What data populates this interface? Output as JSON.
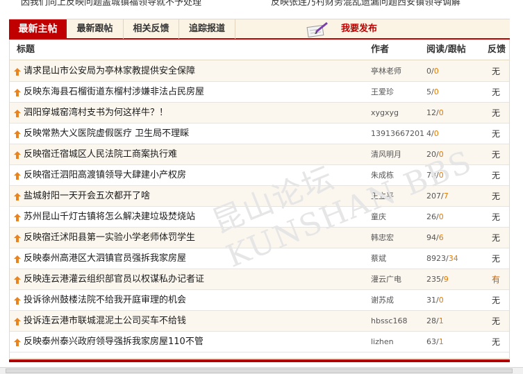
{
  "top": {
    "left_text": "因我们向上反映问题盖城镇福领导就不予处理",
    "right_text": "反映张连乃村财务混乱遗漏问题西安镇领导调解"
  },
  "tabs": [
    {
      "label": "最新主帖",
      "active": true
    },
    {
      "label": "最新跟帖",
      "active": false
    },
    {
      "label": "相关反馈",
      "active": false
    },
    {
      "label": "追踪报道",
      "active": false
    }
  ],
  "publish": {
    "label": "我要发布",
    "icon": "pen-notepad-icon"
  },
  "columns": {
    "title": "标题",
    "author": "作者",
    "stats": "阅读/跟帖",
    "feedback": "反馈"
  },
  "colors": {
    "accent": "#c00000",
    "reply": "#e07b00"
  },
  "watermark": "昆山论坛 KUNSHAN BBS",
  "rows": [
    {
      "title": "请求昆山市公安局为亭林家教提供安全保障",
      "author": "亭林老师",
      "reads": "0",
      "replies": "0",
      "feedback": "无"
    },
    {
      "title": "反映东海县石榴街道东榴村涉嫌非法占民房屋",
      "author": "王爱珍",
      "reads": "5",
      "replies": "0",
      "feedback": "无"
    },
    {
      "title": "泗阳穿城窑湾村支书为何这样牛？！",
      "author": "xygxyg",
      "reads": "12",
      "replies": "0",
      "feedback": "无"
    },
    {
      "title": "反映常熟大义医院虚假医疗  卫生局不理睬",
      "author": "13913667201",
      "reads": "4",
      "replies": "0",
      "feedback": "无"
    },
    {
      "title": "反映宿迁宿城区人民法院工商案执行难",
      "author": "清风明月",
      "reads": "20",
      "replies": "0",
      "feedback": "无"
    },
    {
      "title": "反映宿迁泗阳高渡镇领导大肆建小产权房",
      "author": "朱成栋",
      "reads": "78",
      "replies": "0",
      "feedback": "无"
    },
    {
      "title": "盐城射阳一天开会五次都开了啥",
      "author": "王立平",
      "reads": "207",
      "replies": "7",
      "feedback": "无"
    },
    {
      "title": "苏州昆山千灯古镇将怎么解决建垃圾焚烧站",
      "author": "童庆",
      "reads": "26",
      "replies": "0",
      "feedback": "无"
    },
    {
      "title": "反映宿迁沭阳县第一实验小学老师体罚学生",
      "author": "韩忠宏",
      "reads": "94",
      "replies": "6",
      "feedback": "无"
    },
    {
      "title": "反映泰州高港区大泗镇官员强拆我家房屋",
      "author": "蔡斌",
      "reads": "8923",
      "replies": "34",
      "feedback": "无"
    },
    {
      "title": "反映连云港灌云组织部官员以权谋私办记者证",
      "author": "灌云广电",
      "reads": "235",
      "replies": "9",
      "feedback": "有"
    },
    {
      "title": "投诉徐州鼓楼法院不给我开庭审理的机会",
      "author": "谢苏成",
      "reads": "31",
      "replies": "0",
      "feedback": "无"
    },
    {
      "title": "投诉连云港市联城混泥土公司买车不给钱",
      "author": "hbssc168",
      "reads": "28",
      "replies": "1",
      "feedback": "无"
    },
    {
      "title": "反映泰州泰兴政府领导强拆我家房屋110不管",
      "author": "lizhen",
      "reads": "63",
      "replies": "1",
      "feedback": "无"
    }
  ]
}
